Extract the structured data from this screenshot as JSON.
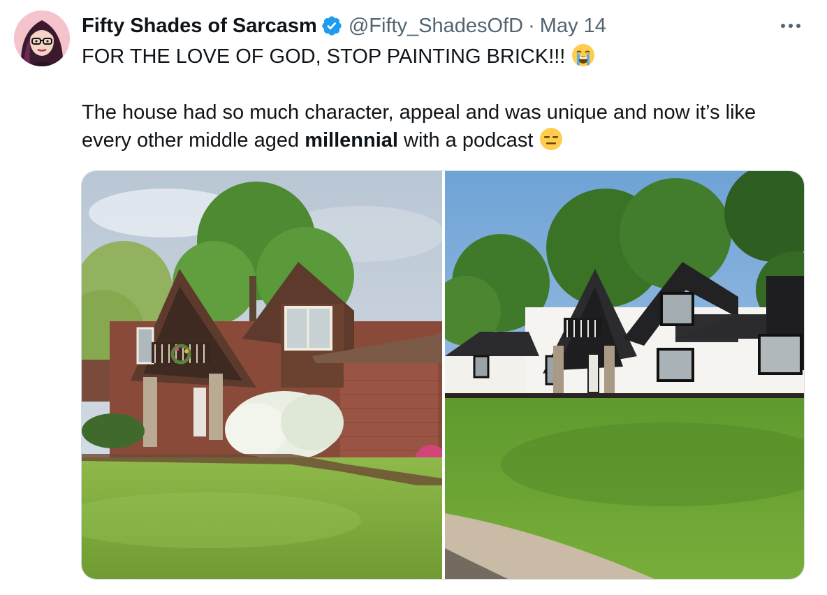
{
  "author": {
    "display_name": "Fifty Shades of Sarcasm",
    "handle": "@Fifty_ShadesOfD",
    "separator": "·",
    "date": "May 14",
    "verified": true,
    "avatar_icon": "avatar-woman-glasses"
  },
  "tweet": {
    "line1": "FOR THE LOVE OF GOD, STOP PAINTING BRICK!!!",
    "line1_emoji": "loudly-crying-face",
    "line2": "The house had so much character, appeal and was unique and now it’s like",
    "line3_before": "every other middle aged ",
    "line3_bold": "millennial",
    "line3_after": " with a podcast",
    "line3_emoji": "expressionless-face"
  },
  "media": [
    {
      "name": "before-photo",
      "subject": "brown brick tudor-style house with stone columns and white flowering shrubs"
    },
    {
      "name": "after-photo",
      "subject": "same house with brick painted white and black trim"
    }
  ],
  "colors": {
    "text": "#0f1419",
    "secondary": "#536471",
    "verified_blue": "#1d9bf0",
    "border": "#cfd9de"
  },
  "icons": {
    "verified": "verified-badge-icon",
    "more": "more-options-icon"
  }
}
